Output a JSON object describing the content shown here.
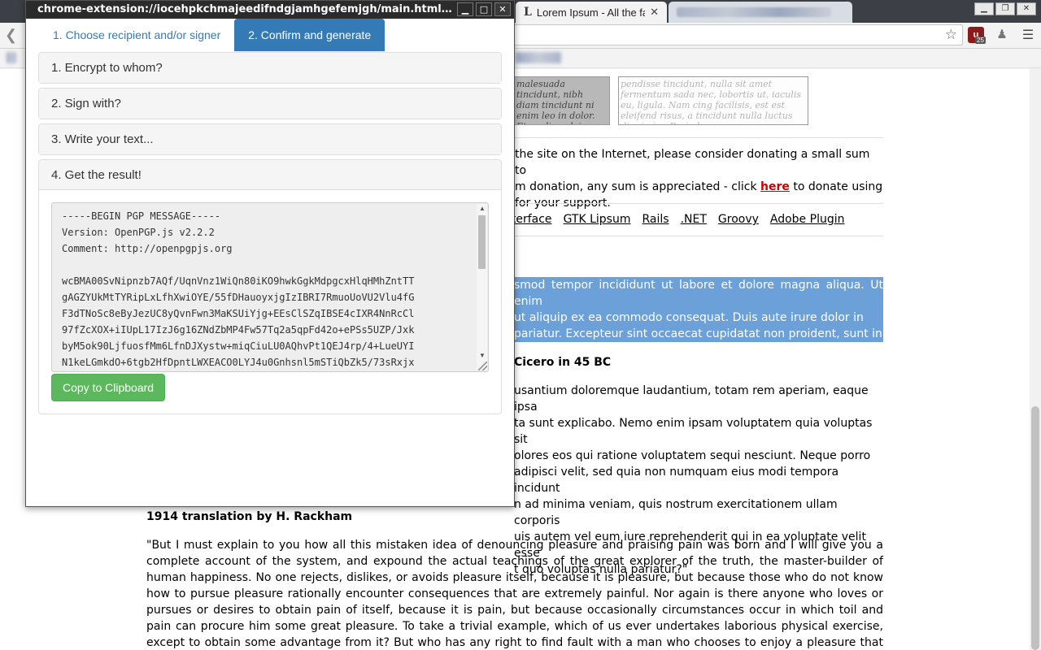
{
  "browser": {
    "tab_lorem_favicon": "L",
    "tab_lorem_title": "Lorem Ipsum - All the fa",
    "tab_close": "✕",
    "ublock_badge": "25"
  },
  "page": {
    "banner_dark_text": "malesuada tincidunt, nibh diam tincidunt ni enim leo in dolor. Et aculis pulvinar nib",
    "banner_light_text": "pendisse tincidunt, nulla sit amet fermentum sada nec, lobortis ut, iaculis eu, ligula. Nam cing facilisis, est est eleifend risus, a tincidunt nulla luctus dignissim. Proin leo massa, commo",
    "donate_1": "the site on the Internet, please consider donating a small sum to",
    "donate_2": "m donation, any sum is appreciated - click",
    "donate_here": "here",
    "donate_3": "to donate using",
    "donate_4": "for your support.",
    "links": [
      "nterface",
      "GTK Lipsum",
      "Rails",
      ".NET",
      "Groovy",
      "Adobe Plugin"
    ],
    "selected_lines": [
      "smod tempor incididunt ut labore et dolore magna aliqua. Ut enim",
      "ut aliquip ex ea commodo consequat. Duis aute irure dolor in",
      "pariatur. Excepteur sint occaecat cupidatat non proident, sunt in"
    ],
    "cicero_heading": "Cicero in 45 BC",
    "cicero_lines": [
      "usantium doloremque laudantium, totam rem aperiam, eaque ipsa",
      "ta sunt explicabo. Nemo enim ipsam voluptatem quia voluptas sit",
      "olores eos qui ratione voluptatem sequi nesciunt. Neque porro",
      "adipisci velit, sed quia non numquam eius modi tempora incidunt",
      "n ad minima veniam, quis nostrum exercitationem ullam corporis",
      "uis autem vel eum iure reprehenderit qui in ea voluptate velit esse",
      "t quo voluptas nulla pariatur?\""
    ],
    "rackham_heading": "1914 translation by H. Rackham",
    "rackham_paragraph": "\"But I must explain to you how all this mistaken idea of denouncing pleasure and praising pain was born and I will give you a complete account of the system, and expound the actual teachings of the great explorer of the truth, the master-builder of human happiness. No one rejects, dislikes, or avoids pleasure itself, because it is pleasure, but because those who do not know how to pursue pleasure rationally encounter consequences that are extremely painful. Nor again is there anyone who loves or pursues or desires to obtain pain of itself, because it is pain, but because occasionally circumstances occur in which toil and pain can procure him some great pleasure. To take a trivial example, which of us ever undertakes laborious physical exercise, except to obtain some advantage from it? But who has any right to find fault with a man who chooses to enjoy a pleasure that has no annoying"
  },
  "popup": {
    "title": "chrome-extension://iocehpkchmajeedifndgjamhgefemjgh/main.html#popup-co…",
    "win_minimize": "▁",
    "win_maximize": "□",
    "win_close": "✕",
    "steps": [
      {
        "label": "1. Choose recipient and/or signer",
        "active": false
      },
      {
        "label": "2. Confirm and generate",
        "active": true
      }
    ],
    "panels": [
      {
        "title": "1. Encrypt to whom?"
      },
      {
        "title": "2. Sign with?"
      },
      {
        "title": "3. Write your text..."
      },
      {
        "title": "4. Get the result!"
      }
    ],
    "pgp_message": "-----BEGIN PGP MESSAGE-----\nVersion: OpenPGP.js v2.2.2\nComment: http://openpgpjs.org\n\nwcBMA00SvNipnzb7AQf/UqnVnz1WiQn80iKO9hwkGgkMdpgcxHlqHMhZntTT\ngAGZYUkMtTYRipLxLfhXwiOYE/55fDHauoyxjgIzIBRI7RmuoUoVU2Vlu4fG\nF3dTNoSc8eByJezUC8yQvnFwn3MaKSUiYjg+EEsClSZqIBSE4cIXR4NnRcCl\n97fZcXOX+iIUpL17IzJ6g16ZNdZbMP4Fw57Tq2a5qpFd42o+ePSs5UZP/Jxk\nbyM5ok90LjfuosfMm6LfnDJXystw+miqCiuLU0AQhvPt1QEJ4rp/4+LueUYI\nN1keLGmkdO+6tgb2HfDpntLWXEACO0LYJ4u0Gnhsnl5mSTiQbZk5/73sRxjx",
    "copy_button": "Copy to Clipboard"
  }
}
